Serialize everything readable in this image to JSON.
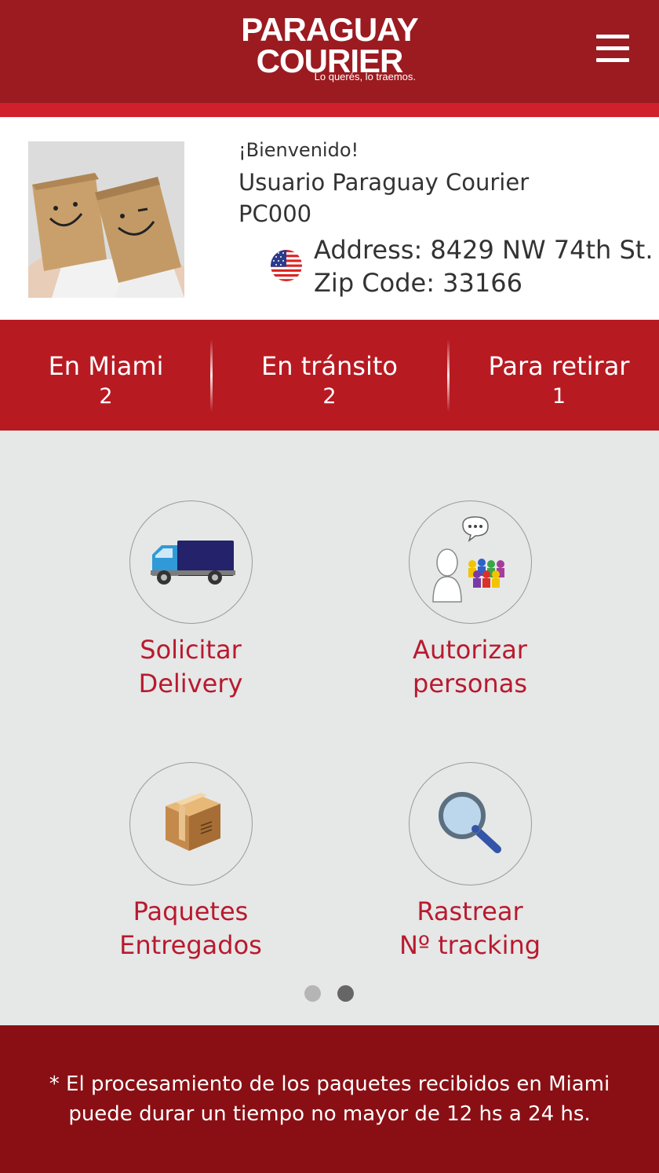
{
  "header": {
    "logo_line1": "PARAGUAY",
    "logo_line2": "COURIER",
    "logo_tagline": "Lo querés, lo traemos.",
    "menu_icon": "hamburger-menu-icon"
  },
  "profile": {
    "welcome": "¡Bienvenido!",
    "user_name": "Usuario Paraguay Courier",
    "user_code": "PC000",
    "address": "Address: 8429 NW 74th St.",
    "zip": "Zip Code: 33166",
    "flag_icon": "us-flag-icon"
  },
  "stats": [
    {
      "label": "En Miami",
      "count": "2"
    },
    {
      "label": "En tránsito",
      "count": "2"
    },
    {
      "label": "Para retirar",
      "count": "1"
    }
  ],
  "tiles": [
    {
      "line1": "Solicitar",
      "line2": "Delivery",
      "icon": "delivery-truck-icon"
    },
    {
      "line1": "Autorizar",
      "line2": "personas",
      "icon": "authorize-people-icon"
    },
    {
      "line1": "Paquetes",
      "line2": "Entregados",
      "icon": "package-box-icon"
    },
    {
      "line1": "Rastrear",
      "line2": "Nº tracking",
      "icon": "magnifier-icon"
    }
  ],
  "pagination": {
    "pages": 2,
    "active": 2
  },
  "footer": {
    "line1": "* El procesamiento de los paquetes recibidos en Miami",
    "line2": "puede durar un tiempo no mayor de 12 hs a 24 hs."
  },
  "colors": {
    "header": "#9b1b21",
    "stripe": "#d0202b",
    "stats_bar": "#b81a22",
    "tile_text": "#b81a2e",
    "footer": "#8a0f14",
    "background": "#e6e7e7"
  }
}
